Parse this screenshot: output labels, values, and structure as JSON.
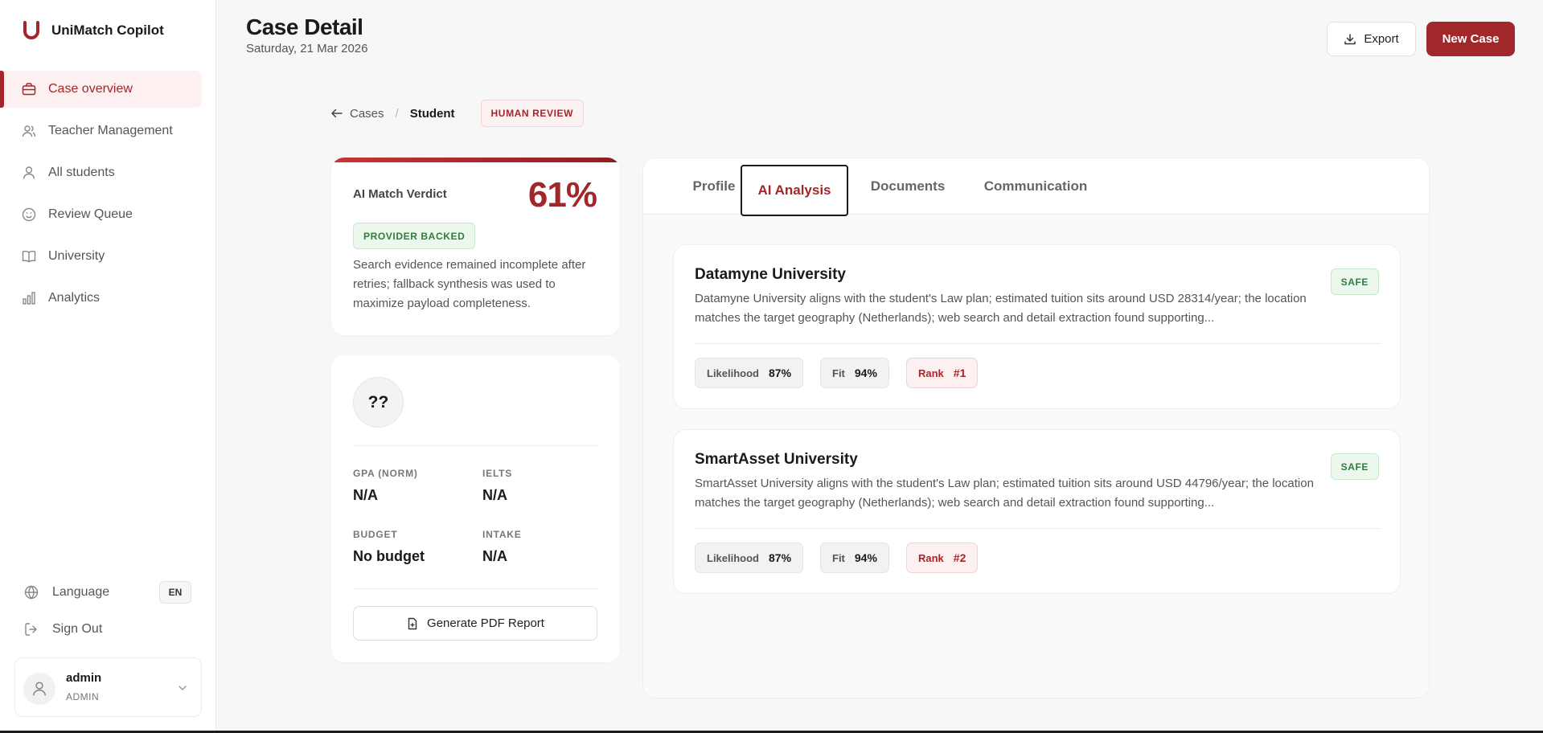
{
  "app": {
    "name": "UniMatch Copilot"
  },
  "sidebar": {
    "items": [
      {
        "label": "Case overview",
        "icon": "briefcase-icon",
        "active": true
      },
      {
        "label": "Teacher Management",
        "icon": "users-icon",
        "active": false
      },
      {
        "label": "All students",
        "icon": "user-icon",
        "active": false
      },
      {
        "label": "Review Queue",
        "icon": "smile-icon",
        "active": false
      },
      {
        "label": "University",
        "icon": "book-icon",
        "active": false
      },
      {
        "label": "Analytics",
        "icon": "bar-chart-icon",
        "active": false
      }
    ],
    "language_label": "Language",
    "language_value": "EN",
    "signout_label": "Sign Out",
    "user": {
      "name": "admin",
      "role": "ADMIN"
    }
  },
  "header": {
    "title": "Case Detail",
    "date": "Saturday, 21 Mar 2026",
    "export_label": "Export",
    "new_case_label": "New Case"
  },
  "breadcrumb": {
    "back_label": "Cases",
    "separator": "/",
    "current": "Student",
    "status_badge": "HUMAN REVIEW"
  },
  "verdict": {
    "label": "AI Match Verdict",
    "percent": "61%",
    "badge": "PROVIDER BACKED",
    "text": "Search evidence remained incomplete after retries; fallback synthesis was used to maximize payload completeness."
  },
  "student": {
    "initials": "??",
    "stats": {
      "gpa_label": "GPA (NORM)",
      "gpa_value": "N/A",
      "ielts_label": "IELTS",
      "ielts_value": "N/A",
      "budget_label": "BUDGET",
      "budget_value": "No budget",
      "intake_label": "INTAKE",
      "intake_value": "N/A"
    },
    "pdf_button": "Generate PDF Report"
  },
  "tabs": [
    {
      "label": "Profile",
      "active": false
    },
    {
      "label": "AI Analysis",
      "active": true
    },
    {
      "label": "Documents",
      "active": false
    },
    {
      "label": "Communication",
      "active": false
    }
  ],
  "universities": [
    {
      "name": "Datamyne University",
      "description": "Datamyne University aligns with the student's Law plan; estimated tuition sits around USD 28314/year; the location matches the target geography (Netherlands); web search and detail extraction found supporting...",
      "badge": "SAFE",
      "likelihood_label": "Likelihood",
      "likelihood_value": "87%",
      "fit_label": "Fit",
      "fit_value": "94%",
      "rank_label": "Rank",
      "rank_value": "#1"
    },
    {
      "name": "SmartAsset University",
      "description": "SmartAsset University aligns with the student's Law plan; estimated tuition sits around USD 44796/year; the location matches the target geography (Netherlands); web search and detail extraction found supporting...",
      "badge": "SAFE",
      "likelihood_label": "Likelihood",
      "likelihood_value": "87%",
      "fit_label": "Fit",
      "fit_value": "94%",
      "rank_label": "Rank",
      "rank_value": "#2"
    }
  ],
  "colors": {
    "accent": "#a2272a",
    "safe_green": "#2e7d3d",
    "background": "#f7f7f7"
  }
}
